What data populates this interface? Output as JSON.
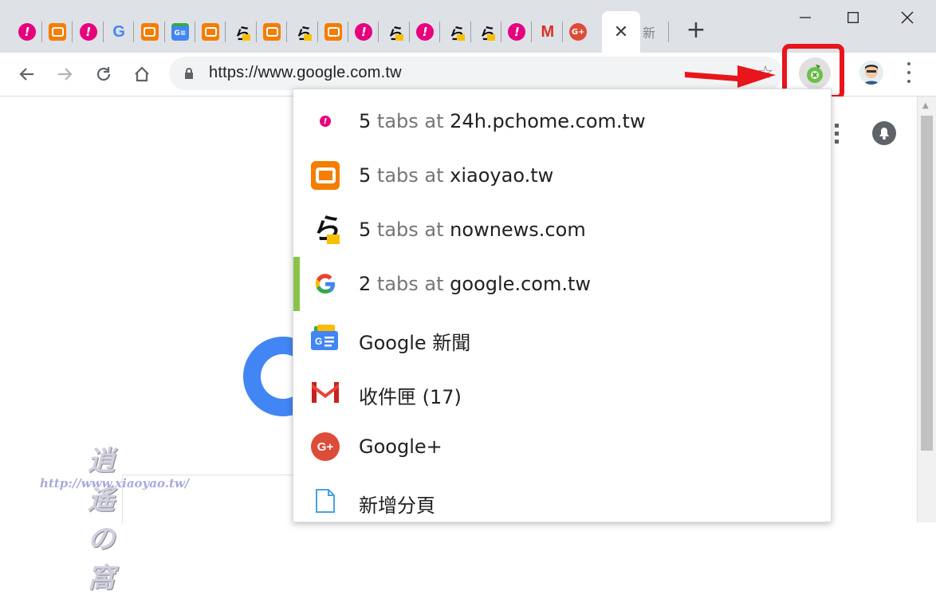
{
  "tabs": [
    {
      "icon": "pchome-icon",
      "glyph": "!"
    },
    {
      "icon": "blogger-icon",
      "glyph": ""
    },
    {
      "icon": "pchome-icon",
      "glyph": "!"
    },
    {
      "icon": "google-icon",
      "glyph": "G"
    },
    {
      "icon": "blogger-icon",
      "glyph": ""
    },
    {
      "icon": "google-news-icon",
      "glyph": "G≡"
    },
    {
      "icon": "blogger-icon",
      "glyph": ""
    },
    {
      "icon": "nownews-icon",
      "glyph": "ら"
    },
    {
      "icon": "blogger-icon",
      "glyph": ""
    },
    {
      "icon": "nownews-icon",
      "glyph": "ら"
    },
    {
      "icon": "blogger-icon",
      "glyph": ""
    },
    {
      "icon": "pchome-icon",
      "glyph": "!"
    },
    {
      "icon": "nownews-icon",
      "glyph": "ら"
    },
    {
      "icon": "pchome-icon",
      "glyph": "!"
    },
    {
      "icon": "nownews-icon",
      "glyph": "ら"
    },
    {
      "icon": "nownews-icon",
      "glyph": "ら"
    },
    {
      "icon": "pchome-icon",
      "glyph": "!"
    },
    {
      "icon": "gmail-icon",
      "glyph": "M"
    },
    {
      "icon": "google-plus-icon",
      "glyph": "G+"
    }
  ],
  "active_tab": {
    "close_glyph": "✕"
  },
  "new_tab_label": "新",
  "new_tab_button": "+",
  "window": {
    "minimize": "—",
    "maximize": "☐",
    "close": "✕"
  },
  "omnibox": {
    "url": "https://www.google.com.tw",
    "star": "☆"
  },
  "extension": {
    "icon": "tab-manager-icon"
  },
  "colors": {
    "highlight": "#e8151b",
    "selected_bar": "#8bc34a"
  },
  "dropdown": {
    "items": [
      {
        "icon": "pchome-icon",
        "count": "5",
        "mid": "tabs at",
        "site": "24h.pchome.com.tw"
      },
      {
        "icon": "blogger-icon",
        "count": "5",
        "mid": "tabs at",
        "site": "xiaoyao.tw"
      },
      {
        "icon": "nownews-icon",
        "count": "5",
        "mid": "tabs at",
        "site": "nownews.com"
      },
      {
        "icon": "google-icon",
        "count": "2",
        "mid": "tabs at",
        "site": "google.com.tw",
        "selected": true
      },
      {
        "icon": "google-news-icon",
        "title": "Google 新聞"
      },
      {
        "icon": "gmail-icon",
        "title": "收件匣 (17)"
      },
      {
        "icon": "google-plus-icon",
        "title": "Google+"
      },
      {
        "icon": "new-tab-page-icon",
        "title": "新增分頁"
      }
    ]
  },
  "watermark": {
    "title": "逍遙の窩",
    "url": "http://www.xiaoyao.tw/"
  }
}
